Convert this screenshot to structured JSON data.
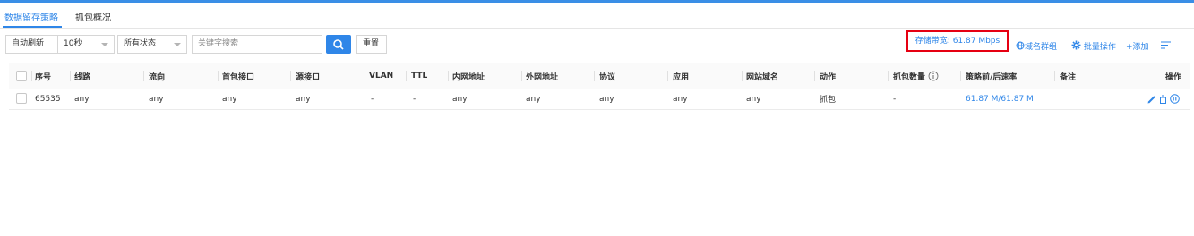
{
  "tabs": [
    {
      "label": "数据留存策略",
      "active": true
    },
    {
      "label": "抓包概况",
      "active": false
    }
  ],
  "toolbar": {
    "auto_refresh_label": "自动刷新",
    "interval_value": "10秒",
    "status_value": "所有状态",
    "search_placeholder": "关键字搜索",
    "reset_label": "重置",
    "storage_bandwidth": "存储带宽: 61.87 Mbps",
    "domain_group_label": "域名群组",
    "batch_label": "批量操作",
    "add_label": "+添加"
  },
  "table": {
    "headers": [
      "序号",
      "线路",
      "流向",
      "首包接口",
      "源接口",
      "VLAN",
      "TTL",
      "内网地址",
      "外网地址",
      "协议",
      "应用",
      "网站域名",
      "动作",
      "抓包数量",
      "策略前/后速率",
      "备注",
      "操作"
    ],
    "rows": [
      {
        "id": "65535",
        "line": "any",
        "direction": "any",
        "first_iface": "any",
        "src_iface": "any",
        "vlan": "-",
        "ttl": "-",
        "inner_addr": "any",
        "outer_addr": "any",
        "protocol": "any",
        "app": "any",
        "domain": "any",
        "action": "抓包",
        "capture_count": "-",
        "rate": "61.87 M/61.87 M",
        "remark": ""
      }
    ]
  },
  "colors": {
    "accent": "#2f86e8",
    "highlight_border": "#e60012"
  }
}
